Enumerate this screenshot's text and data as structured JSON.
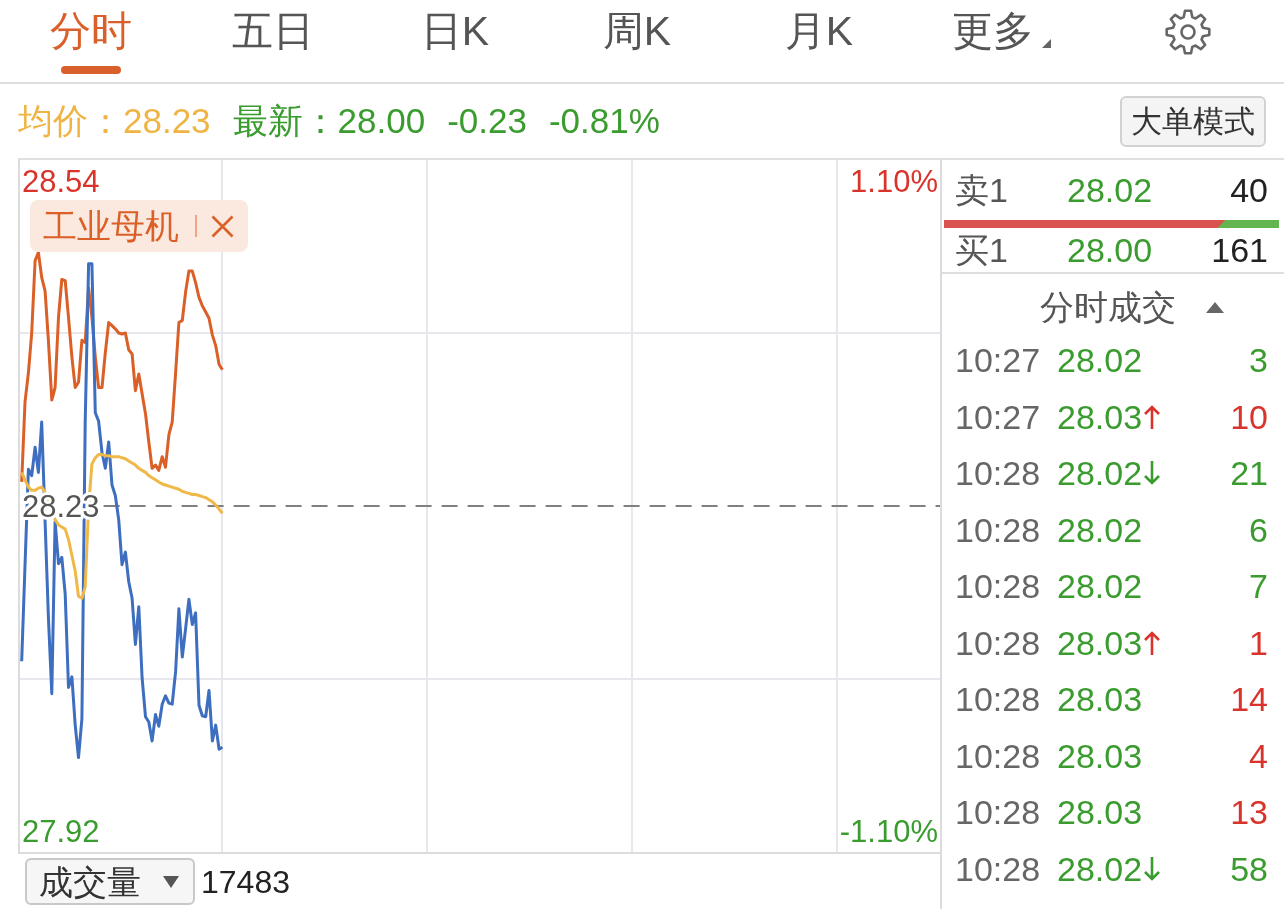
{
  "tabs": [
    {
      "label": "分时",
      "kind": "tab",
      "selected": true
    },
    {
      "label": "五日",
      "kind": "tab",
      "selected": false
    },
    {
      "label": "日K",
      "kind": "tab",
      "selected": false
    },
    {
      "label": "周K",
      "kind": "tab",
      "selected": false
    },
    {
      "label": "月K",
      "kind": "tab",
      "selected": false
    },
    {
      "label": "更多",
      "kind": "menu",
      "selected": false
    }
  ],
  "quote": {
    "average_label": "均价：",
    "average": "28.23",
    "latest_label": "最新：",
    "latest": "28.00",
    "change": "-0.23",
    "change_percent": "-0.81%"
  },
  "mode_button": {
    "label": "大单模式"
  },
  "chart": {
    "chart_data": [
      {
        "type": "line",
        "categories": [
          null,
          null,
          null,
          null,
          null,
          null,
          null,
          null,
          null,
          null,
          null,
          null,
          null,
          null,
          null,
          null,
          null,
          null,
          null,
          null,
          null,
          null,
          null,
          null,
          null,
          null,
          null,
          null,
          null,
          null,
          null,
          null,
          null,
          null,
          null,
          null,
          null,
          null,
          null,
          null,
          null,
          null,
          null,
          null,
          null,
          null,
          null,
          null,
          null,
          null,
          null,
          null,
          null,
          null,
          null,
          null,
          null,
          null,
          null,
          null,
          null,
          null,
          null,
          null,
          null,
          null,
          null,
          null,
          null,
          null,
          null,
          null,
          null,
          null,
          null,
          null,
          null,
          null,
          null,
          null,
          null,
          null,
          null,
          null,
          null,
          null,
          null,
          null,
          null,
          null,
          null,
          null,
          null,
          null,
          null,
          null,
          null,
          null,
          null,
          null,
          null,
          null,
          null,
          null,
          null,
          null,
          null,
          null,
          null,
          null,
          null,
          null,
          null,
          null,
          null,
          null,
          null,
          null,
          null,
          null,
          null,
          null,
          null,
          null,
          null,
          null,
          null,
          null,
          null,
          null,
          null,
          null,
          null,
          null,
          null,
          null,
          null,
          null,
          null,
          null,
          null,
          null,
          null,
          null,
          null,
          null,
          null,
          null,
          null,
          null,
          null,
          null,
          null,
          null,
          null,
          null,
          null,
          null,
          null,
          null,
          null,
          null,
          null,
          null,
          null,
          null,
          null,
          null,
          null,
          null,
          null,
          null,
          null,
          null,
          null,
          null,
          null,
          null,
          null,
          null,
          null,
          null,
          null,
          null,
          null,
          null,
          null,
          null,
          null,
          null,
          null,
          null,
          null,
          null,
          null,
          null,
          null,
          null,
          null,
          null,
          null,
          null,
          null,
          null,
          null,
          null,
          null,
          null,
          null,
          null,
          null,
          null,
          null,
          null,
          null,
          null,
          null,
          null,
          null,
          null,
          null,
          null,
          null,
          null,
          null,
          null,
          null,
          null,
          null,
          null,
          null,
          null,
          null,
          null,
          null,
          null,
          null,
          null,
          null,
          null,
          null,
          null,
          null,
          null,
          null,
          null,
          null,
          null,
          null,
          null,
          null,
          null,
          null,
          null,
          null,
          null,
          null,
          null,
          null,
          null,
          null,
          null,
          null,
          null,
          null,
          null,
          null,
          null,
          null,
          null,
          null,
          null,
          null,
          null,
          null
        ],
        "ylim": [
          27.9,
          28.56
        ],
        "yticks": [
          {
            "value": 28.54,
            "label": "28.54"
          },
          {
            "value": 28.23,
            "label": "28.23"
          },
          {
            "value": 27.92,
            "label": "27.92"
          }
        ],
        "y2lim": [
          -1.17,
          1.17
        ],
        "y2ticks": [
          {
            "value": 1.1,
            "label": "1.10%"
          },
          {
            "value": -1.1,
            "label": "-1.10%"
          }
        ],
        "ref_lines": [
          {
            "axis": "y",
            "value": 28.23,
            "color": "#808080",
            "line_style": "dashed"
          }
        ],
        "grid": true,
        "series": [
          {
            "name": "工业母机",
            "color": "#db6027",
            "values": [
              28.253,
              28.329,
              28.357,
              28.395,
              28.464,
              28.472,
              28.448,
              28.435,
              28.388,
              28.331,
              28.343,
              28.41,
              28.446,
              28.445,
              28.41,
              28.372,
              28.343,
              28.348,
              28.388,
              28.386,
              28.438,
              28.41,
              28.372,
              28.343,
              28.343,
              28.376,
              28.405,
              28.402,
              28.399,
              28.395,
              28.394,
              28.395,
              28.379,
              28.375,
              28.34,
              28.356,
              28.337,
              28.318,
              28.291,
              28.266,
              28.269,
              28.264,
              28.277,
              28.267,
              28.298,
              28.31,
              28.357,
              28.405,
              28.407,
              28.434,
              28.454,
              28.454,
              28.443,
              28.429,
              28.421,
              28.415,
              28.409,
              28.393,
              28.383,
              28.365,
              28.36,
              null,
              null,
              null,
              null,
              null,
              null,
              null,
              null,
              null,
              null,
              null,
              null,
              null,
              null,
              null,
              null,
              null,
              null,
              null,
              null,
              null,
              null,
              null,
              null,
              null,
              null,
              null,
              null,
              null,
              null,
              null,
              null,
              null,
              null,
              null,
              null,
              null,
              null,
              null,
              null,
              null,
              null,
              null,
              null,
              null,
              null,
              null,
              null,
              null,
              null,
              null,
              null,
              null,
              null,
              null,
              null,
              null,
              null,
              null,
              null,
              null,
              null,
              null,
              null,
              null,
              null,
              null,
              null,
              null,
              null,
              null,
              null,
              null,
              null,
              null,
              null,
              null,
              null,
              null,
              null,
              null,
              null,
              null,
              null,
              null,
              null,
              null,
              null,
              null,
              null,
              null,
              null,
              null,
              null,
              null,
              null,
              null,
              null,
              null,
              null,
              null,
              null,
              null,
              null,
              null,
              null,
              null,
              null,
              null,
              null,
              null,
              null,
              null,
              null,
              null,
              null,
              null,
              null,
              null,
              null,
              null,
              null,
              null,
              null,
              null,
              null,
              null,
              null,
              null,
              null,
              null,
              null,
              null,
              null,
              null,
              null,
              null,
              null,
              null,
              null,
              null,
              null,
              null,
              null,
              null,
              null,
              null,
              null,
              null,
              null,
              null,
              null,
              null,
              null,
              null,
              null,
              null,
              null,
              null,
              null,
              null,
              null,
              null,
              null,
              null,
              null,
              null,
              null,
              null,
              null,
              null,
              null,
              null,
              null,
              null,
              null,
              null,
              null,
              null,
              null,
              null,
              null,
              null,
              null,
              null,
              null,
              null,
              null,
              null,
              null,
              null,
              null,
              null,
              null,
              null,
              null,
              null,
              null,
              null,
              null,
              null,
              null,
              null,
              null,
              null,
              null,
              null,
              null,
              null,
              null,
              null,
              null,
              null,
              null
            ]
          },
          {
            "color": "#3e6ec0",
            "values": [
              28.082,
              28.173,
              28.265,
              28.259,
              28.286,
              28.262,
              28.31,
              28.215,
              28.124,
              28.051,
              28.215,
              28.175,
              28.181,
              28.146,
              28.057,
              28.067,
              28.021,
              27.99,
              28.027,
              28.31,
              28.461,
              28.461,
              28.319,
              28.311,
              28.281,
              28.266,
              28.291,
              28.25,
              28.24,
              28.217,
              28.174,
              28.186,
              28.158,
              28.142,
              28.098,
              28.134,
              28.066,
              28.029,
              28.024,
              28.006,
              28.031,
              28.02,
              28.041,
              28.049,
              28.042,
              28.041,
              28.072,
              28.132,
              28.086,
              28.113,
              28.141,
              28.117,
              28.128,
              28.04,
              28.03,
              28.029,
              28.054,
              28.006,
              28.021,
              27.998,
              28.0,
              null,
              null,
              null,
              null,
              null,
              null,
              null,
              null,
              null,
              null,
              null,
              null,
              null,
              null,
              null,
              null,
              null,
              null,
              null,
              null,
              null,
              null,
              null,
              null,
              null,
              null,
              null,
              null,
              null,
              null,
              null,
              null,
              null,
              null,
              null,
              null,
              null,
              null,
              null,
              null,
              null,
              null,
              null,
              null,
              null,
              null,
              null,
              null,
              null,
              null,
              null,
              null,
              null,
              null,
              null,
              null,
              null,
              null,
              null,
              null,
              null,
              null,
              null,
              null,
              null,
              null,
              null,
              null,
              null,
              null,
              null,
              null,
              null,
              null,
              null,
              null,
              null,
              null,
              null,
              null,
              null,
              null,
              null,
              null,
              null,
              null,
              null,
              null,
              null,
              null,
              null,
              null,
              null,
              null,
              null,
              null,
              null,
              null,
              null,
              null,
              null,
              null,
              null,
              null,
              null,
              null,
              null,
              null,
              null,
              null,
              null,
              null,
              null,
              null,
              null,
              null,
              null,
              null,
              null,
              null,
              null,
              null,
              null,
              null,
              null,
              null,
              null,
              null,
              null,
              null,
              null,
              null,
              null,
              null,
              null,
              null,
              null,
              null,
              null,
              null,
              null,
              null,
              null,
              null,
              null,
              null,
              null,
              null,
              null,
              null,
              null,
              null,
              null,
              null,
              null,
              null,
              null,
              null,
              null,
              null,
              null,
              null,
              null,
              null,
              null,
              null,
              null,
              null,
              null,
              null,
              null,
              null,
              null,
              null,
              null,
              null,
              null,
              null,
              null,
              null,
              null,
              null,
              null,
              null,
              null,
              null,
              null,
              null,
              null,
              null,
              null,
              null,
              null,
              null,
              null,
              null,
              null,
              null,
              null,
              null,
              null,
              null,
              null,
              null,
              null,
              null,
              null,
              null,
              null,
              null,
              null,
              null,
              null,
              null
            ]
          },
          {
            "color": "#f0b848",
            "values": [
              28.262,
              28.255,
              28.248,
              28.245,
              28.245,
              28.247,
              28.248,
              28.243,
              28.236,
              28.228,
              28.217,
              28.212,
              28.21,
              28.208,
              28.198,
              28.183,
              28.168,
              28.144,
              28.142,
              28.153,
              28.229,
              28.27,
              28.276,
              28.279,
              28.279,
              28.278,
              28.278,
              28.277,
              28.277,
              28.277,
              28.276,
              28.275,
              28.273,
              28.271,
              28.269,
              28.266,
              28.264,
              28.262,
              28.259,
              28.257,
              28.255,
              28.253,
              28.251,
              28.25,
              28.249,
              28.248,
              28.247,
              28.246,
              28.244,
              28.243,
              28.242,
              28.241,
              28.241,
              28.24,
              28.239,
              28.238,
              28.236,
              28.234,
              28.231,
              28.227,
              28.223,
              null,
              null,
              null,
              null,
              null,
              null,
              null,
              null,
              null,
              null,
              null,
              null,
              null,
              null,
              null,
              null,
              null,
              null,
              null,
              null,
              null,
              null,
              null,
              null,
              null,
              null,
              null,
              null,
              null,
              null,
              null,
              null,
              null,
              null,
              null,
              null,
              null,
              null,
              null,
              null,
              null,
              null,
              null,
              null,
              null,
              null,
              null,
              null,
              null,
              null,
              null,
              null,
              null,
              null,
              null,
              null,
              null,
              null,
              null,
              null,
              null,
              null,
              null,
              null,
              null,
              null,
              null,
              null,
              null,
              null,
              null,
              null,
              null,
              null,
              null,
              null,
              null,
              null,
              null,
              null,
              null,
              null,
              null,
              null,
              null,
              null,
              null,
              null,
              null,
              null,
              null,
              null,
              null,
              null,
              null,
              null,
              null,
              null,
              null,
              null,
              null,
              null,
              null,
              null,
              null,
              null,
              null,
              null,
              null,
              null,
              null,
              null,
              null,
              null,
              null,
              null,
              null,
              null,
              null,
              null,
              null,
              null,
              null,
              null,
              null,
              null,
              null,
              null,
              null,
              null,
              null,
              null,
              null,
              null,
              null,
              null,
              null,
              null,
              null,
              null,
              null,
              null,
              null,
              null,
              null,
              null,
              null,
              null,
              null,
              null,
              null,
              null,
              null,
              null,
              null,
              null,
              null,
              null,
              null,
              null,
              null,
              null,
              null,
              null,
              null,
              null,
              null,
              null,
              null,
              null,
              null,
              null,
              null,
              null,
              null,
              null,
              null,
              null,
              null,
              null,
              null,
              null,
              null,
              null,
              null,
              null,
              null,
              null,
              null,
              null,
              null,
              null,
              null,
              null,
              null,
              null,
              null,
              null,
              null,
              null,
              null,
              null,
              null,
              null,
              null,
              null,
              null,
              null,
              null,
              null,
              null,
              null,
              null,
              null
            ]
          }
        ]
      }
    ]
  },
  "order_book": [
    {
      "label": "卖1",
      "price": "28.02",
      "volume": "40"
    },
    {
      "label": "买1",
      "price": "28.00",
      "volume": "161"
    }
  ],
  "order_ratio": {
    "level": 0.84
  },
  "trades_header": {
    "title": "分时成交"
  },
  "trades": [
    {
      "time": "10:27",
      "price": "28.02",
      "kind": "flat",
      "volume": "3",
      "color": "#3a9b2f"
    },
    {
      "time": "10:27",
      "price": "28.03",
      "kind": "up",
      "volume": "10",
      "color": "#d9342b"
    },
    {
      "time": "10:28",
      "price": "28.02",
      "kind": "down",
      "volume": "21",
      "color": "#3a9b2f"
    },
    {
      "time": "10:28",
      "price": "28.02",
      "kind": "flat",
      "volume": "6",
      "color": "#3a9b2f"
    },
    {
      "time": "10:28",
      "price": "28.02",
      "kind": "flat",
      "volume": "7",
      "color": "#3a9b2f"
    },
    {
      "time": "10:28",
      "price": "28.03",
      "kind": "up",
      "volume": "1",
      "color": "#d9342b"
    },
    {
      "time": "10:28",
      "price": "28.03",
      "kind": "flat",
      "volume": "14",
      "color": "#d9342b"
    },
    {
      "time": "10:28",
      "price": "28.03",
      "kind": "flat",
      "volume": "4",
      "color": "#d9342b"
    },
    {
      "time": "10:28",
      "price": "28.03",
      "kind": "flat",
      "volume": "13",
      "color": "#d9342b"
    },
    {
      "time": "10:28",
      "price": "28.02",
      "kind": "down",
      "volume": "58",
      "color": "#3a9b2f"
    }
  ],
  "indicator": {
    "selector": "成交量",
    "value": "17483"
  }
}
